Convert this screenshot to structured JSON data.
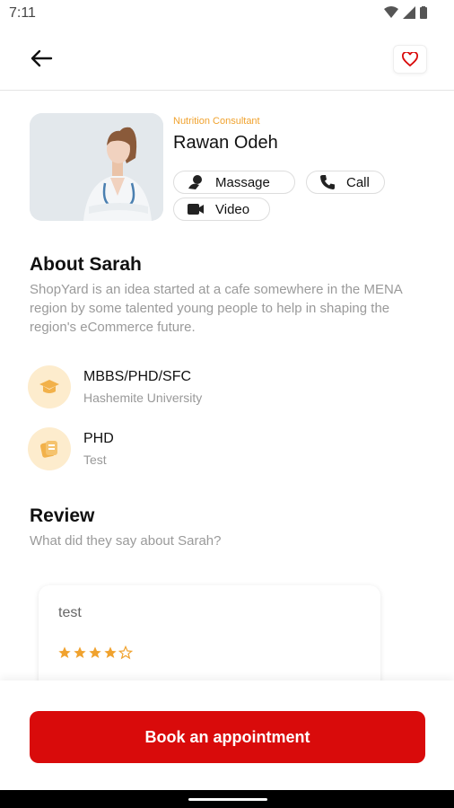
{
  "status": {
    "time": "7:11"
  },
  "profile": {
    "role": "Nutrition Consultant",
    "name": "Rawan Odeh",
    "services": [
      "Massage",
      "Call",
      "Video"
    ]
  },
  "about": {
    "title": "About Sarah",
    "text": "ShopYard is an idea started at a cafe somewhere in the MENA region by some talented young people to help in shaping the region's eCommerce future."
  },
  "education": [
    {
      "title": "MBBS/PHD/SFC",
      "subtitle": "Hashemite University",
      "icon": "graduation-cap-icon"
    },
    {
      "title": "PHD",
      "subtitle": "Test",
      "icon": "certificate-icon"
    }
  ],
  "review": {
    "title": "Review",
    "subtitle": "What did they say about Sarah?",
    "items": [
      {
        "text": "test",
        "rating": 4,
        "max_rating": 5
      }
    ]
  },
  "cta": {
    "label": "Book an appointment"
  },
  "colors": {
    "primary": "#d90b0b",
    "accent": "#f0a22e",
    "icon_bg": "#fdeccd"
  }
}
